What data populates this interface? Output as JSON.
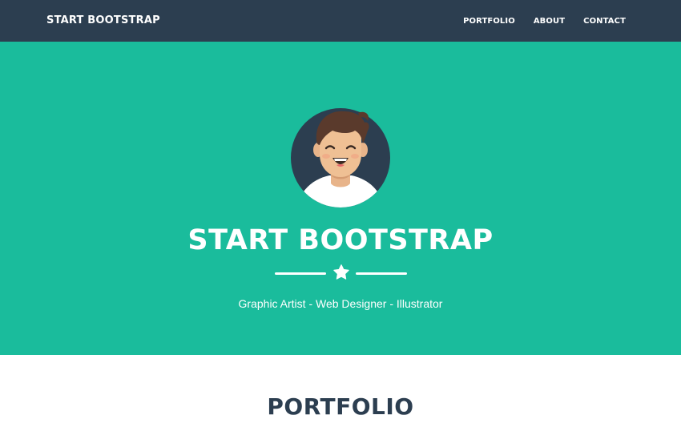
{
  "navbar": {
    "brand": "START BOOTSTRAP",
    "links": [
      "PORTFOLIO",
      "ABOUT",
      "CONTACT"
    ]
  },
  "masthead": {
    "title": "START BOOTSTRAP",
    "subheading": "Graphic Artist - Web Designer - Illustrator",
    "divider_icon": "star-icon",
    "avatar_icon": "avatar-icon"
  },
  "portfolio": {
    "title": "PORTFOLIO"
  },
  "colors": {
    "navbar_bg": "#2c3e50",
    "masthead_bg": "#1abc9c",
    "heading_dark": "#2c3e50",
    "text_light": "#ffffff"
  }
}
